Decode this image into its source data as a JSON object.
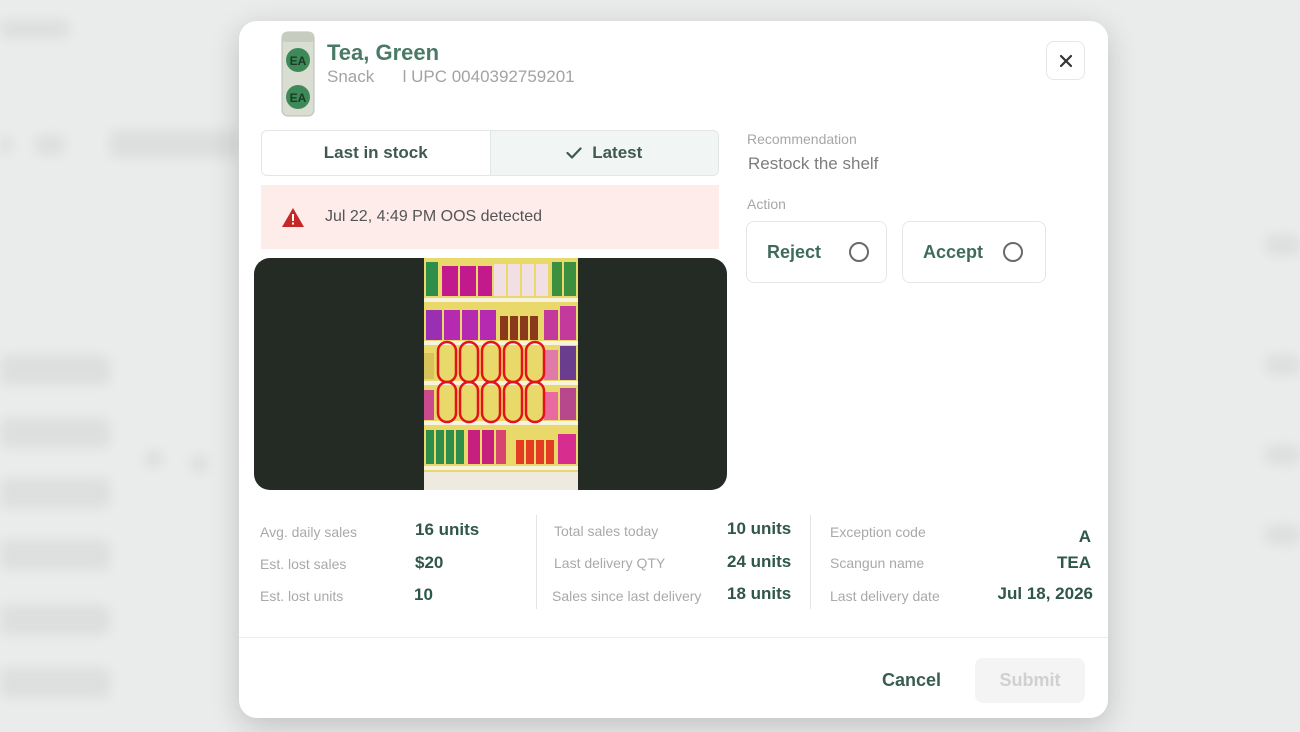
{
  "product": {
    "name": "Tea, Green",
    "category": "Snack",
    "upc": "l UPC 0040392759201",
    "thumb_text": "EA"
  },
  "tabs": [
    {
      "label": "Last in stock",
      "active": false
    },
    {
      "label": "Latest",
      "active": true
    }
  ],
  "alert": {
    "text": "Jul 22, 4:49 PM OOS detected"
  },
  "recommendation": {
    "label": "Recommendation",
    "value": "Restock the shelf"
  },
  "action": {
    "label": "Action",
    "reject_label": "Reject",
    "accept_label": "Accept"
  },
  "stats": {
    "col1": [
      {
        "label": "Avg. daily sales",
        "value": "16 units"
      },
      {
        "label": "Est. lost sales",
        "value": "$20"
      },
      {
        "label": "Est. lost units",
        "value": "10"
      }
    ],
    "col2": [
      {
        "label": "Total sales today",
        "value": "10 units"
      },
      {
        "label": "Last delivery QTY",
        "value": "24 units"
      },
      {
        "label": "Sales since last delivery",
        "value": "18 units"
      }
    ],
    "col3": [
      {
        "label": "Exception code",
        "value": "A"
      },
      {
        "label": "Scangun name",
        "value": "TEA"
      },
      {
        "label": "Last delivery date",
        "value": "Jul 18, 2026"
      }
    ]
  },
  "footer": {
    "cancel_label": "Cancel",
    "submit_label": "Submit"
  },
  "colors": {
    "brand_green": "#4a7a66",
    "alert_bg": "#fdecea",
    "alert_icon": "#c62828",
    "oos_highlight": "#e3121b"
  }
}
